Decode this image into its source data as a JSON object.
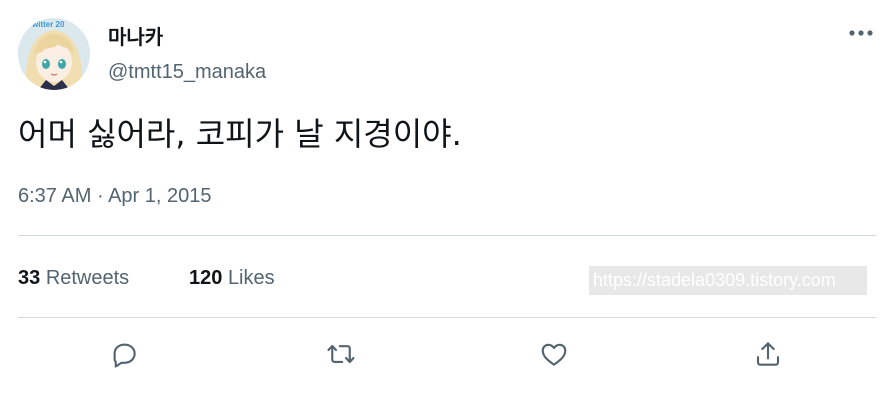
{
  "tweet": {
    "display_name": "마나카",
    "handle": "@tmtt15_manaka",
    "text": "어머 싫어라, 코피가 날 지경이야.",
    "time": "6:37 AM",
    "separator": "·",
    "date": "Apr 1, 2015",
    "avatar_overlay_text": "witter 20"
  },
  "stats": {
    "retweets_count": "33",
    "retweets_label": "Retweets",
    "likes_count": "120",
    "likes_label": "Likes"
  },
  "watermark": "https://stadela0309.tistory.com",
  "icons": {
    "more": "more-horizontal-icon",
    "reply": "reply-icon",
    "retweet": "retweet-icon",
    "like": "heart-icon",
    "share": "share-icon"
  },
  "colors": {
    "primary_text": "#0f1419",
    "secondary_text": "#536471",
    "divider": "#cfd9de"
  }
}
